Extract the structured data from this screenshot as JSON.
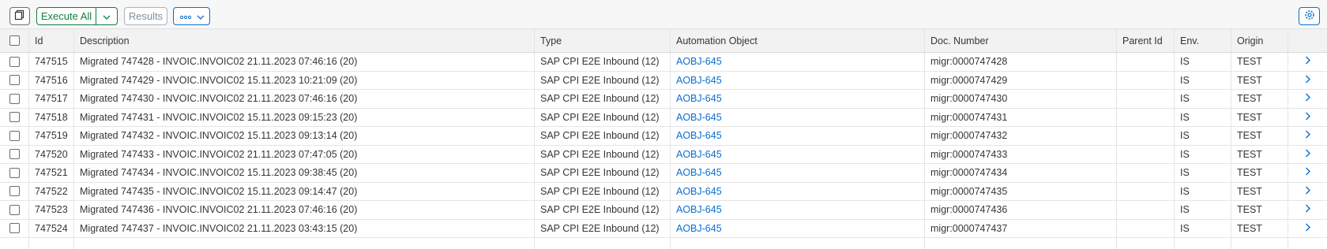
{
  "toolbar": {
    "execute_label": "Execute All",
    "results_label": "Results"
  },
  "columns": {
    "id": "Id",
    "description": "Description",
    "type": "Type",
    "automation_object": "Automation Object",
    "doc_number": "Doc. Number",
    "parent_id": "Parent Id",
    "env": "Env.",
    "origin": "Origin"
  },
  "rows": [
    {
      "id": "747515",
      "description": "Migrated 747428 - INVOIC.INVOIC02 21.11.2023 07:46:16 (20)",
      "type": "SAP CPI E2E Inbound (12)",
      "automation_object": "AOBJ-645",
      "doc_number": "migr:0000747428",
      "parent_id": "",
      "env": "IS",
      "origin": "TEST"
    },
    {
      "id": "747516",
      "description": "Migrated 747429 - INVOIC.INVOIC02 15.11.2023 10:21:09 (20)",
      "type": "SAP CPI E2E Inbound (12)",
      "automation_object": "AOBJ-645",
      "doc_number": "migr:0000747429",
      "parent_id": "",
      "env": "IS",
      "origin": "TEST"
    },
    {
      "id": "747517",
      "description": "Migrated 747430 - INVOIC.INVOIC02 21.11.2023 07:46:16 (20)",
      "type": "SAP CPI E2E Inbound (12)",
      "automation_object": "AOBJ-645",
      "doc_number": "migr:0000747430",
      "parent_id": "",
      "env": "IS",
      "origin": "TEST"
    },
    {
      "id": "747518",
      "description": "Migrated 747431 - INVOIC.INVOIC02 15.11.2023 09:15:23 (20)",
      "type": "SAP CPI E2E Inbound (12)",
      "automation_object": "AOBJ-645",
      "doc_number": "migr:0000747431",
      "parent_id": "",
      "env": "IS",
      "origin": "TEST"
    },
    {
      "id": "747519",
      "description": "Migrated 747432 - INVOIC.INVOIC02 15.11.2023 09:13:14 (20)",
      "type": "SAP CPI E2E Inbound (12)",
      "automation_object": "AOBJ-645",
      "doc_number": "migr:0000747432",
      "parent_id": "",
      "env": "IS",
      "origin": "TEST"
    },
    {
      "id": "747520",
      "description": "Migrated 747433 - INVOIC.INVOIC02 21.11.2023 07:47:05 (20)",
      "type": "SAP CPI E2E Inbound (12)",
      "automation_object": "AOBJ-645",
      "doc_number": "migr:0000747433",
      "parent_id": "",
      "env": "IS",
      "origin": "TEST"
    },
    {
      "id": "747521",
      "description": "Migrated 747434 - INVOIC.INVOIC02 15.11.2023 09:38:45 (20)",
      "type": "SAP CPI E2E Inbound (12)",
      "automation_object": "AOBJ-645",
      "doc_number": "migr:0000747434",
      "parent_id": "",
      "env": "IS",
      "origin": "TEST"
    },
    {
      "id": "747522",
      "description": "Migrated 747435 - INVOIC.INVOIC02 15.11.2023 09:14:47 (20)",
      "type": "SAP CPI E2E Inbound (12)",
      "automation_object": "AOBJ-645",
      "doc_number": "migr:0000747435",
      "parent_id": "",
      "env": "IS",
      "origin": "TEST"
    },
    {
      "id": "747523",
      "description": "Migrated 747436 - INVOIC.INVOIC02 21.11.2023 07:46:16 (20)",
      "type": "SAP CPI E2E Inbound (12)",
      "automation_object": "AOBJ-645",
      "doc_number": "migr:0000747436",
      "parent_id": "",
      "env": "IS",
      "origin": "TEST"
    },
    {
      "id": "747524",
      "description": "Migrated 747437 - INVOIC.INVOIC02 21.11.2023 03:43:15 (20)",
      "type": "SAP CPI E2E Inbound (12)",
      "automation_object": "AOBJ-645",
      "doc_number": "migr:0000747437",
      "parent_id": "",
      "env": "IS",
      "origin": "TEST"
    }
  ],
  "icons": {
    "copy": "copy-icon",
    "execute_dropdown": "chevron-down-icon",
    "more": "overflow-icon",
    "settings": "gear-icon",
    "row_nav": "chevron-right-icon"
  },
  "colors": {
    "accent": "#0a6ed1",
    "execute": "#107e3e",
    "disabled": "#a9b4be"
  }
}
